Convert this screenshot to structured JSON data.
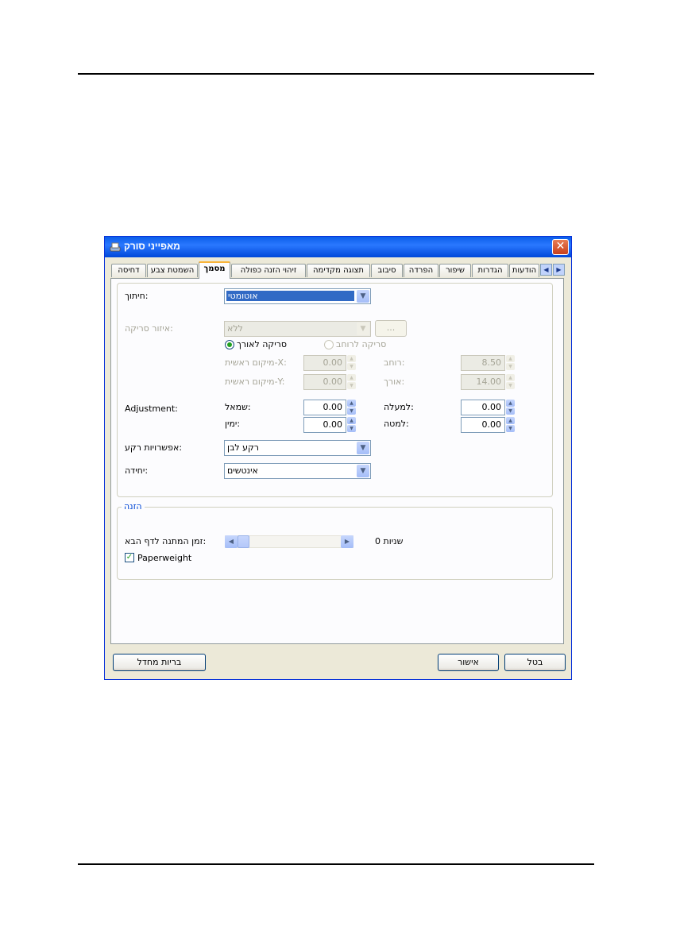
{
  "window": {
    "title": "מאפייני סורק",
    "close_label": "✕"
  },
  "tabs": [
    {
      "label": "דחיסה"
    },
    {
      "label": "השמטת צבע"
    },
    {
      "label": "מסמך"
    },
    {
      "label": "זיהוי הזנה כפולה"
    },
    {
      "label": "תצוגה מקדימה"
    },
    {
      "label": "סיבוב"
    },
    {
      "label": "הפרדה"
    },
    {
      "label": "שיפור"
    },
    {
      "label": "הגדרות"
    },
    {
      "label": "הודעות"
    }
  ],
  "document": {
    "cropping_label": "חיתוך:",
    "cropping_value": "אוטומטי",
    "scan_area_label": "איזור סריקה:",
    "scan_area_value": "ללא",
    "browse_label": "...",
    "radio_landscape": "סריקה לרוחב",
    "radio_portrait": "סריקה לאורך",
    "x_origin_label": "מיקום ראשית-X:",
    "x_origin_value": "0.00",
    "y_origin_label": "מיקום ראשית-Y:",
    "y_origin_value": "0.00",
    "width_label": "רוחב:",
    "width_value": "8.50",
    "length_label": "אורך:",
    "length_value": "14.00",
    "adjustment_label": "Adjustment:",
    "left_label": "שמאל:",
    "left_value": "0.00",
    "right_label": "ימין:",
    "right_value": "0.00",
    "top_label": "למעלה:",
    "top_value": "0.00",
    "bottom_label": "למטה:",
    "bottom_value": "0.00",
    "background_label": "אפשרויות רקע:",
    "background_value": "רקע לבן",
    "unit_label": "יחידה:",
    "unit_value": "אינטשים"
  },
  "feeding": {
    "group_title": "הזנה",
    "wait_label": "זמן המתנה לדף הבא:",
    "wait_value": "0 שניות",
    "wait_level": 0,
    "paperweight_label": "Paperweight",
    "paperweight_checked": true
  },
  "footer": {
    "defaults_label": "בריות מחדל",
    "ok_label": "אישור",
    "cancel_label": "בטל"
  }
}
